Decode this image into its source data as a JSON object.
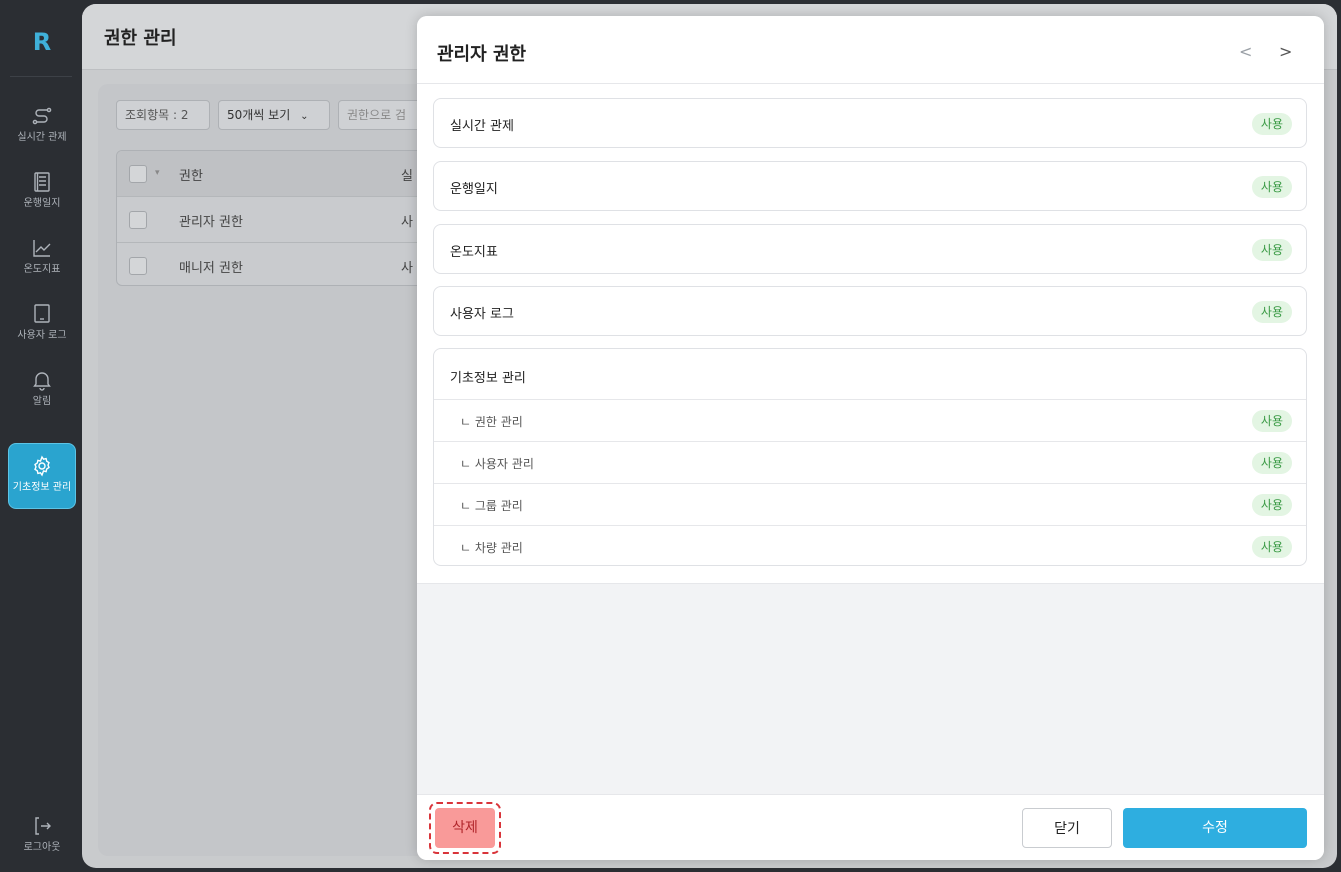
{
  "sidebar": {
    "logo": "R",
    "items": [
      {
        "label": "실시간 관제",
        "icon": "route-icon"
      },
      {
        "label": "운행일지",
        "icon": "document-icon"
      },
      {
        "label": "온도지표",
        "icon": "chart-line-icon"
      },
      {
        "label": "사용자 로그",
        "icon": "tablet-icon"
      },
      {
        "label": "알림",
        "icon": "bell-icon"
      },
      {
        "label": "기초정보 관리",
        "icon": "gear-icon",
        "active": true
      }
    ],
    "logout_label": "로그아웃"
  },
  "page": {
    "title": "권한 관리",
    "count_chip": "조회항목 : 2",
    "page_size": "50개씩 보기",
    "search_placeholder": "권한으로 검",
    "table": {
      "columns": [
        "권한",
        "실"
      ],
      "rows": [
        {
          "name": "관리자 권한",
          "col2": "사"
        },
        {
          "name": "매니저 권한",
          "col2": "사"
        }
      ]
    }
  },
  "modal": {
    "title": "관리자 권한",
    "prev": "<",
    "next": ">",
    "permissions": [
      {
        "label": "실시간 관제",
        "status": "사용"
      },
      {
        "label": "운행일지",
        "status": "사용"
      },
      {
        "label": "온도지표",
        "status": "사용"
      },
      {
        "label": "사용자 로그",
        "status": "사용"
      }
    ],
    "group": {
      "title": "기초정보 관리",
      "items": [
        {
          "label": "ㄴ 권한 관리",
          "status": "사용"
        },
        {
          "label": "ㄴ 사용자 관리",
          "status": "사용"
        },
        {
          "label": "ㄴ 그룹 관리",
          "status": "사용"
        },
        {
          "label": "ㄴ 차량 관리",
          "status": "사용"
        }
      ]
    },
    "footer": {
      "delete_label": "삭제",
      "close_label": "닫기",
      "edit_label": "수정"
    }
  },
  "colors": {
    "accent": "#2eaee0",
    "badge_bg": "#e3f5e3",
    "badge_text": "#3a9a45",
    "delete_bg": "#f99a99"
  }
}
